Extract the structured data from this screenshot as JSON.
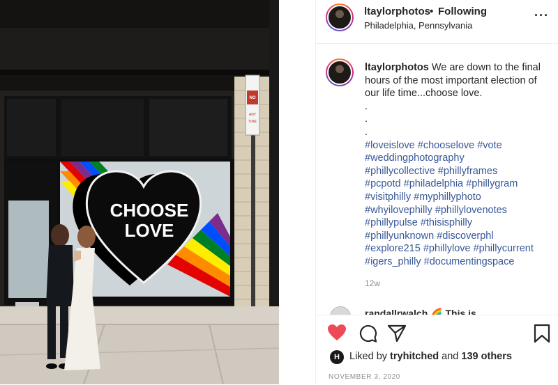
{
  "post": {
    "username": "ltaylorphotos",
    "follow_separator": "•",
    "follow_status": "Following",
    "location": "Philadelphia, Pennsylvania",
    "more_icon": "more-horizontal-icon",
    "more_label": "···"
  },
  "photo": {
    "heart_text_line1": "CHOOSE",
    "heart_text_line2": "LOVE",
    "sign_no": "NO",
    "sign_parking": "STANDING",
    "sign_any": "ANY",
    "sign_time": "TIME",
    "sign_top": "TOW AWAY ZONE"
  },
  "caption": {
    "username": "ltaylorphotos",
    "text": "We are down to the final hours of the most important election of our life time...choose love.",
    "dots": [
      ".",
      ".",
      "."
    ],
    "hashtags": [
      [
        "#loveislove",
        "#chooselove",
        "#vote"
      ],
      [
        "#weddingphotography"
      ],
      [
        "#phillycollective",
        "#phillyframes"
      ],
      [
        "#pcpotd",
        "#philadelphia",
        "#phillygram"
      ],
      [
        "#visitphilly",
        "#myphillyphoto"
      ],
      [
        "#whyilovephilly",
        "#phillylovenotes"
      ],
      [
        "#phillypulse",
        "#thisisphilly"
      ],
      [
        "#phillyunknown",
        "#discoverphl"
      ],
      [
        "#explore215",
        "#phillylove",
        "#phillycurrent"
      ],
      [
        "#igers_philly",
        "#documentingspace"
      ]
    ],
    "time_ago": "12w"
  },
  "next_comment": {
    "text": "randallrwalch 🌈 This is"
  },
  "actions": {
    "liked_by_label": "Liked by",
    "liker": "tryhitched",
    "and_label": "and",
    "others": "139 others",
    "liker_initial": "H",
    "date": "NOVEMBER 3, 2020",
    "like_color": "#ed4956"
  }
}
